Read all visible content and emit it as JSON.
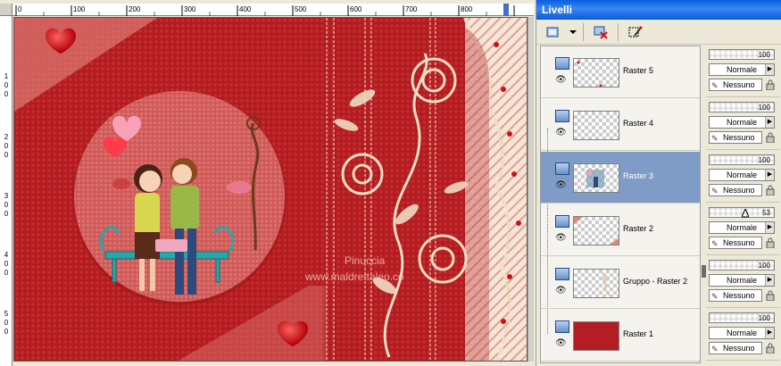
{
  "canvas": {
    "ruler_top_labels": [
      "0",
      "100",
      "200",
      "300",
      "400",
      "500",
      "600",
      "700",
      "800"
    ],
    "ruler_left_labels": [
      "1",
      "0",
      "0",
      "2",
      "0",
      "0",
      "3",
      "0",
      "0",
      "4",
      "0",
      "0",
      "5",
      "0",
      "0"
    ],
    "watermark_line1": "Pinuccia",
    "watermark_line2": "www.maldrettaleo.co"
  },
  "panel": {
    "title": "Livelli",
    "toolbar_icons": [
      "new-layer-icon",
      "dropdown-arrow-icon",
      "delete-layer-icon",
      "edit-selection-icon"
    ]
  },
  "layers": [
    {
      "name": "Raster 5",
      "opacity": "100",
      "blend": "Normale",
      "mask": "Nessuno",
      "selected": false
    },
    {
      "name": "Raster 4",
      "opacity": "100",
      "blend": "Normale",
      "mask": "Nessuno",
      "selected": false
    },
    {
      "name": "Raster 3",
      "opacity": "100",
      "blend": "Normale",
      "mask": "Nessuno",
      "selected": true
    },
    {
      "name": "Raster 2",
      "opacity": "53",
      "blend": "Normale",
      "mask": "Nessuno",
      "selected": false
    },
    {
      "name": "Gruppo - Raster 2",
      "opacity": "100",
      "blend": "Normale",
      "mask": "Nessuno",
      "selected": false
    },
    {
      "name": "Raster 1",
      "opacity": "100",
      "blend": "Normale",
      "mask": "Nessuno",
      "selected": false
    }
  ],
  "colors": {
    "background_red": "#b41e22",
    "selection_blue": "#7f9cc6",
    "title_blue": "#0a5ee0",
    "lace_cream": "#f0dcc4"
  }
}
